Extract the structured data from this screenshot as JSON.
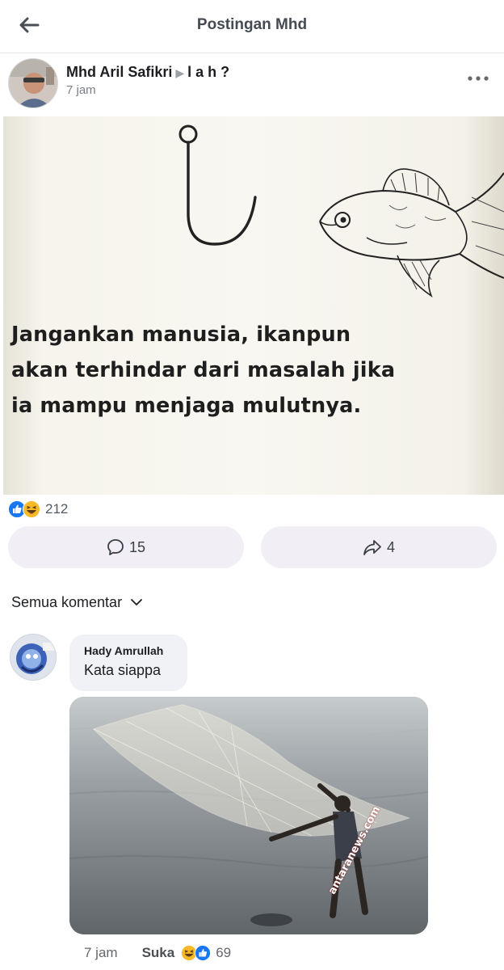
{
  "header": {
    "title": "Postingan Mhd",
    "back_icon": "arrow-left-icon"
  },
  "post": {
    "author": "Mhd Aril Safikri",
    "target": "l a h ?",
    "time": "7 jam",
    "more_icon": "more-horizontal-icon",
    "image_text_lines": [
      "Jangankan manusia, ikanpun",
      "akan terhindar dari masalah jika",
      "ia mampu menjaga mulutnya."
    ],
    "reaction_icons": [
      "like-reaction-icon",
      "haha-reaction-icon"
    ],
    "reaction_count": "212",
    "comment_count": "15",
    "share_count": "4"
  },
  "comments_section": {
    "filter_label": "Semua komentar",
    "filter_icon": "chevron-down-icon"
  },
  "comment": {
    "name": "Hady Amrullah",
    "text": "Kata siappa",
    "watermark": "antaranews.com",
    "time": "7 jam",
    "like_label": "Suka",
    "reaction_icons": [
      "haha-reaction-icon",
      "like-reaction-icon"
    ],
    "reaction_count": "69"
  },
  "colors": {
    "like_blue": "#1877f2",
    "haha_yellow": "#f7b928",
    "button_bg": "#f1eef5",
    "bubble_bg": "#f0f2f5"
  }
}
